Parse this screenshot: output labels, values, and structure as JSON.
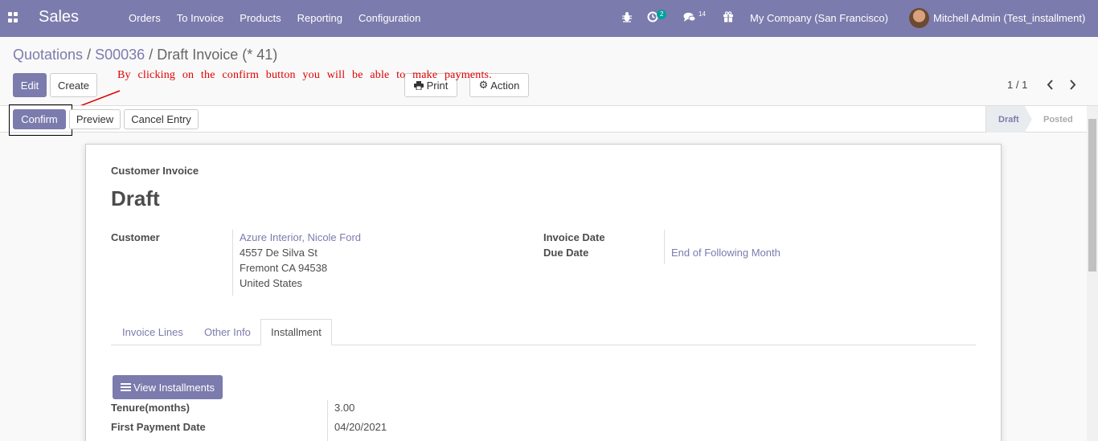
{
  "navbar": {
    "app_name": "Sales",
    "menu": [
      "Orders",
      "To Invoice",
      "Products",
      "Reporting",
      "Configuration"
    ],
    "activity_count": "2",
    "message_count": "14",
    "company": "My Company (San Francisco)",
    "user": "Mitchell Admin (Test_installment)"
  },
  "breadcrumb": {
    "quotations": "Quotations",
    "order": "S00036",
    "current": "Draft Invoice (* 41)",
    "separator": "/"
  },
  "toolbar": {
    "edit": "Edit",
    "create": "Create",
    "print": "Print",
    "action": "Action",
    "pager": "1 / 1"
  },
  "annotation": "By clicking on the confirm button you will be able to make payments.",
  "statusbar": {
    "confirm": "Confirm",
    "preview": "Preview",
    "cancel_entry": "Cancel Entry",
    "stages": [
      "Draft",
      "Posted"
    ]
  },
  "invoice": {
    "type_label": "Customer Invoice",
    "state": "Draft",
    "customer_label": "Customer",
    "customer_name": "Azure Interior, Nicole Ford",
    "address_line1": "4557 De Silva St",
    "address_line2": "Fremont CA 94538",
    "address_line3": "United States",
    "invoice_date_label": "Invoice Date",
    "invoice_date_value": "",
    "due_date_label": "Due Date",
    "due_date_value": "End of Following Month"
  },
  "tabs": [
    "Invoice Lines",
    "Other Info",
    "Installment"
  ],
  "installment": {
    "view_button": "View Installments",
    "tenure_label": "Tenure(months)",
    "tenure_value": "3.00",
    "first_payment_label": "First Payment Date",
    "first_payment_value": "04/20/2021"
  },
  "colors": {
    "brand": "#7c7bad",
    "annotation": "#e00000"
  }
}
